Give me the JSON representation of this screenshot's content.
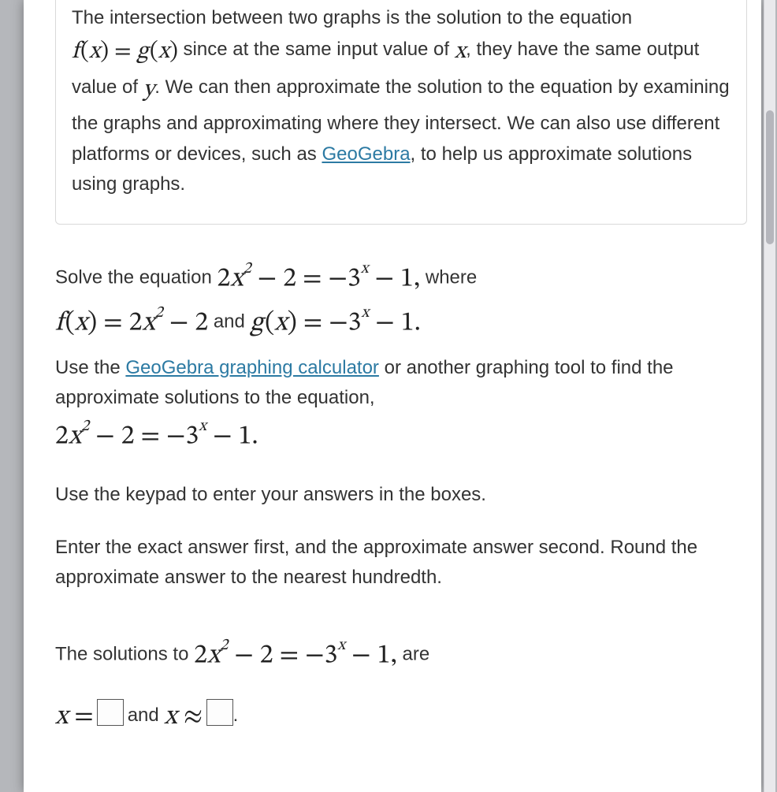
{
  "intro": {
    "part1": "The intersection between two graphs is the solution to the equation ",
    "part2": " since at the same input value of ",
    "part2b": ", they have the same output value of ",
    "part2c": ". ",
    "part3": "We can then approximate the solution to the equation by examining the graphs and approximating where they intersect. We can also use different platforms or devices, such as ",
    "part4": ", to help us approximate solutions using graphs."
  },
  "links": {
    "geogebra": "GeoGebra",
    "geogebraCalc": "GeoGebra graphing calculator"
  },
  "solve": {
    "prefix": "Solve the equation ",
    "where": " where",
    "and": " and "
  },
  "useTool": {
    "prefix": "Use the ",
    "suffix": " or another graphing tool to find the approximate solutions to the equation,"
  },
  "keypad": {
    "text": "Use the keypad to enter your answers in the boxes."
  },
  "exact": {
    "text": "Enter the exact answer first, and the approximate answer second. Round the approximate answer to the nearest hundredth."
  },
  "solutions": {
    "prefix": "The solutions to ",
    "suffix": " are"
  },
  "answers": {
    "and": " and ",
    "period": "."
  },
  "math": {
    "fx_eq_gx": "f(x) = g(x)",
    "main_equation": "2x^2 - 2 = -3^x - 1",
    "fx": "f(x) = 2x^2 - 2",
    "gx": "g(x) = -3^x - 1",
    "x_var": "x",
    "y_var": "y",
    "x_equals": "x =",
    "x_approx": "x ≈"
  }
}
